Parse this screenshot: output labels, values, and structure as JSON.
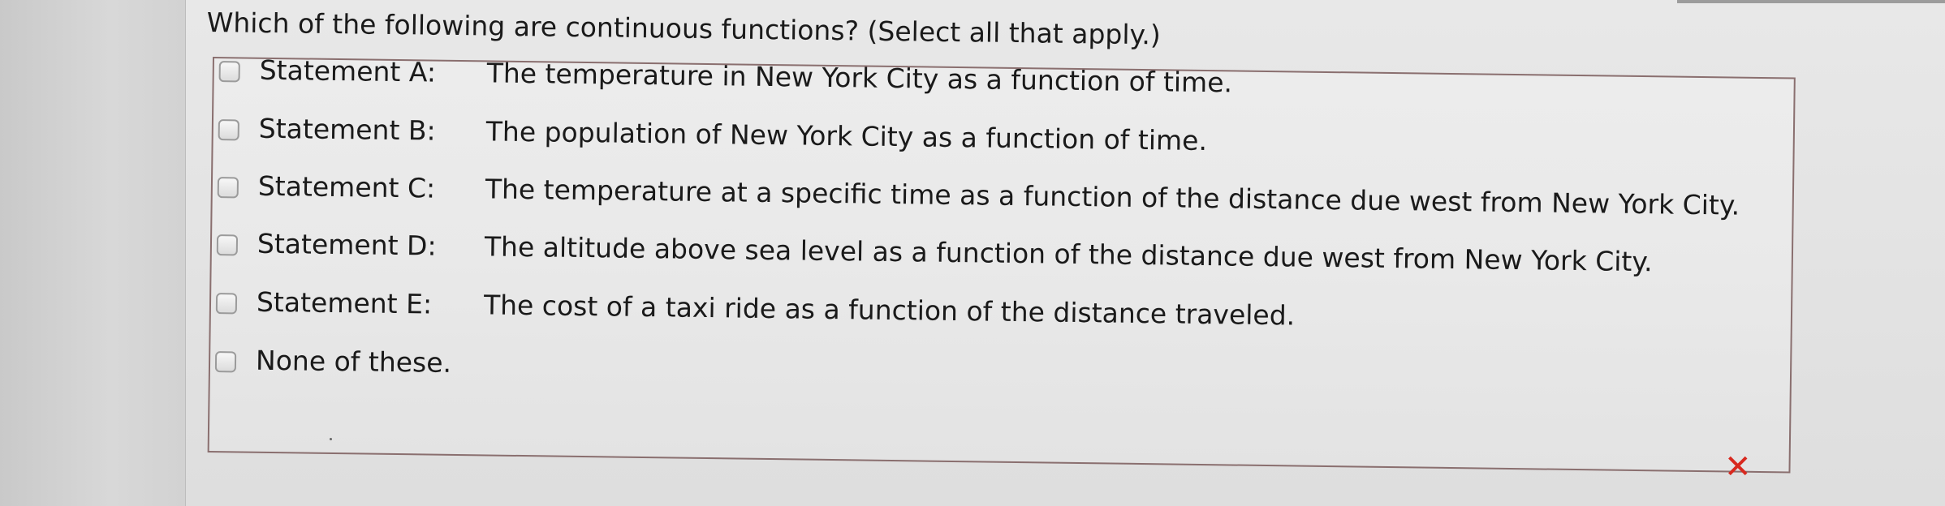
{
  "question": "Which of the following are continuous functions? (Select all that apply.)",
  "options": [
    {
      "label": "Statement A:",
      "text": "The temperature in New York City as a function of time.",
      "checked": false
    },
    {
      "label": "Statement B:",
      "text": "The population of New York City as a function of time.",
      "checked": false
    },
    {
      "label": "Statement C:",
      "text": "The temperature at a specific time as a function of the distance due west from New York City.",
      "checked": false
    },
    {
      "label": "Statement D:",
      "text": "The altitude above sea level as a function of the distance due west from New York City.",
      "checked": false
    },
    {
      "label": "Statement E:",
      "text": "The cost of a taxi ride as a function of the distance traveled.",
      "checked": false
    },
    {
      "label": "None of these.",
      "text": "",
      "checked": false
    }
  ],
  "result": {
    "mark": "✕",
    "color": "#d8281e",
    "meaning": "incorrect"
  }
}
